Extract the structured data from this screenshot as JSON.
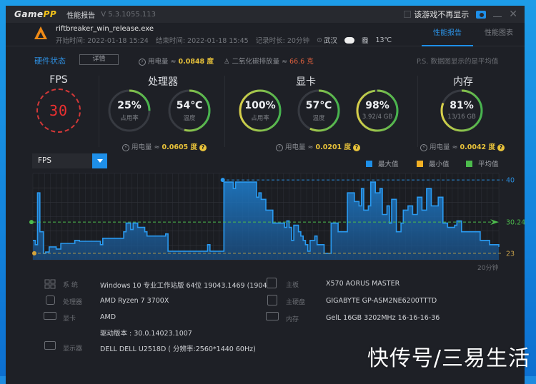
{
  "app": {
    "logo_a": "Game",
    "logo_b": "PP",
    "title": "性能报告",
    "version": "V 5.3.1055.113",
    "hide_game_label": "该游戏不再显示"
  },
  "game": {
    "name": "riftbreaker_win_release.exe",
    "start": "开始时间: 2022-01-18 15:24",
    "end": "结束时间: 2022-01-18 15:45",
    "duration": "记录时长: 20分钟",
    "city": "武汉",
    "weather": "霾",
    "temp": "13℃"
  },
  "tabs": [
    {
      "label": "性能报告",
      "active": true
    },
    {
      "label": "性能图表",
      "active": false
    }
  ],
  "hw": {
    "title": "硬件状态",
    "detail_btn": "详情",
    "power_label": "用电量 ≈ ",
    "power_value": "0.0848 度",
    "co2_label": "二氧化碳排放量 ≈ ",
    "co2_value": "66.6 克",
    "note": "P.S. 数据图显示的是平均值"
  },
  "fps": {
    "title": "FPS",
    "value": "30"
  },
  "cpu": {
    "title": "处理器",
    "usage": {
      "value": "25%",
      "label": "占用率",
      "fraction": 0.25
    },
    "temp": {
      "value": "54℃",
      "label": "温度",
      "fraction": 0.54
    },
    "power_label": "用电量 ≈ ",
    "power_value": "0.0605 度"
  },
  "gpu": {
    "title": "显卡",
    "usage": {
      "value": "100%",
      "label": "占用率",
      "fraction": 1.0
    },
    "temp": {
      "value": "57℃",
      "label": "温度",
      "fraction": 0.57
    },
    "vram": {
      "value": "98%",
      "label": "3.92/4 GB",
      "fraction": 0.98
    },
    "power_label": "用电量 ≈ ",
    "power_value": "0.0201 度"
  },
  "mem": {
    "title": "内存",
    "usage": {
      "value": "81%",
      "label": "13/16 GB",
      "fraction": 0.81
    },
    "power_label": "用电量 ≈ ",
    "power_value": "0.0042 度"
  },
  "selector": {
    "value": "FPS"
  },
  "legend": [
    {
      "label": "最大值",
      "color": "#1e8fe8"
    },
    {
      "label": "最小值",
      "color": "#f2b024"
    },
    {
      "label": "平均值",
      "color": "#4cbb4c"
    }
  ],
  "chart_data": {
    "type": "area",
    "title": "FPS",
    "xlabel": "20分钟",
    "ylabel": "",
    "ylim": [
      21.5,
      41.5
    ],
    "grid": true,
    "max_label": "40",
    "min_label": "23",
    "avg_label": "30.24",
    "max": 40,
    "min": 23,
    "avg": 30.24,
    "x_minutes": [
      0,
      0.1,
      0.2,
      0.3,
      0.45,
      0.5,
      0.55,
      0.7,
      0.9,
      1.0,
      1.2,
      1.3,
      1.5,
      1.8,
      1.9,
      2.0,
      2.9,
      3.0,
      3.2,
      3.9,
      4.0,
      4.2,
      4.3,
      4.5,
      4.7,
      4.8,
      4.9,
      5.6,
      5.7,
      5.8,
      5.9,
      6.1,
      7.4,
      7.5,
      7.6,
      8.1,
      8.2,
      8.3,
      8.5,
      8.6,
      8.7,
      8.8,
      9.6,
      9.7,
      9.8,
      10.0,
      10.3,
      10.4,
      10.6,
      10.8,
      10.9,
      11.0,
      11.1,
      11.2,
      11.4,
      11.5,
      11.6,
      11.7,
      11.8,
      11.9,
      12.1,
      12.2,
      12.5,
      12.6,
      12.8,
      12.9,
      13.1,
      13.3,
      13.5,
      13.6,
      13.8,
      14.0,
      14.1,
      14.2,
      14.4,
      14.5,
      14.6,
      14.7,
      14.9,
      15.0,
      15.2,
      15.3,
      15.4,
      15.6,
      15.8,
      15.9,
      16.1,
      16.3,
      16.5,
      16.7,
      16.9,
      17.1,
      17.4,
      17.6,
      17.8,
      18.1,
      18.2,
      18.4,
      18.7,
      19.2,
      19.6,
      20.0
    ],
    "values": [
      26,
      25,
      37,
      28,
      23,
      23,
      23.3,
      24.5,
      24.5,
      24,
      25.3,
      25.3,
      25.3,
      26,
      26,
      25.8,
      25,
      26.5,
      26.5,
      28,
      30,
      28.5,
      30,
      29,
      29,
      28,
      27,
      27,
      27.5,
      23.5,
      23.5,
      23.5,
      23.5,
      25,
      23.5,
      23.5,
      39.5,
      39.5,
      39.5,
      38,
      39.5,
      39.5,
      36,
      37,
      35.5,
      33,
      30,
      30,
      30,
      29,
      30.5,
      29,
      26,
      29.5,
      28,
      27,
      26,
      25,
      23.5,
      26,
      27,
      25,
      23,
      23,
      30,
      30,
      28,
      28,
      37,
      37,
      35,
      34,
      38,
      33,
      34,
      39.5,
      39.5,
      37,
      38,
      32,
      34,
      30,
      35.5,
      28,
      30,
      33,
      34,
      32,
      36,
      33,
      38,
      34,
      36,
      30,
      29,
      29.5,
      30.5,
      28,
      28,
      26,
      25,
      24.5
    ]
  },
  "system": {
    "os_label": "系 统",
    "os_value": "Windows 10 专业工作站版 64位   19043.1469 (1904",
    "cpu_label": "处理器",
    "cpu_value": "AMD Ryzen 7 3700X",
    "gpu_label": "显卡",
    "gpu_value": "AMD",
    "driver_value": "驱动版本 : 30.0.14023.1007",
    "monitor_label": "显示器",
    "monitor_value": "DELL DELL U2518D ( 分辨率:2560*1440 60Hz)",
    "mb_label": "主板",
    "mb_value": "X570 AORUS MASTER",
    "disk_label": "主硬盘",
    "disk_value": "GIGABYTE GP-ASM2NE6200TTTD",
    "ram_label": "内存",
    "ram_value": "GelL 16GB 3202MHz 16-16-16-36"
  },
  "watermark": "快传号/三易生活"
}
